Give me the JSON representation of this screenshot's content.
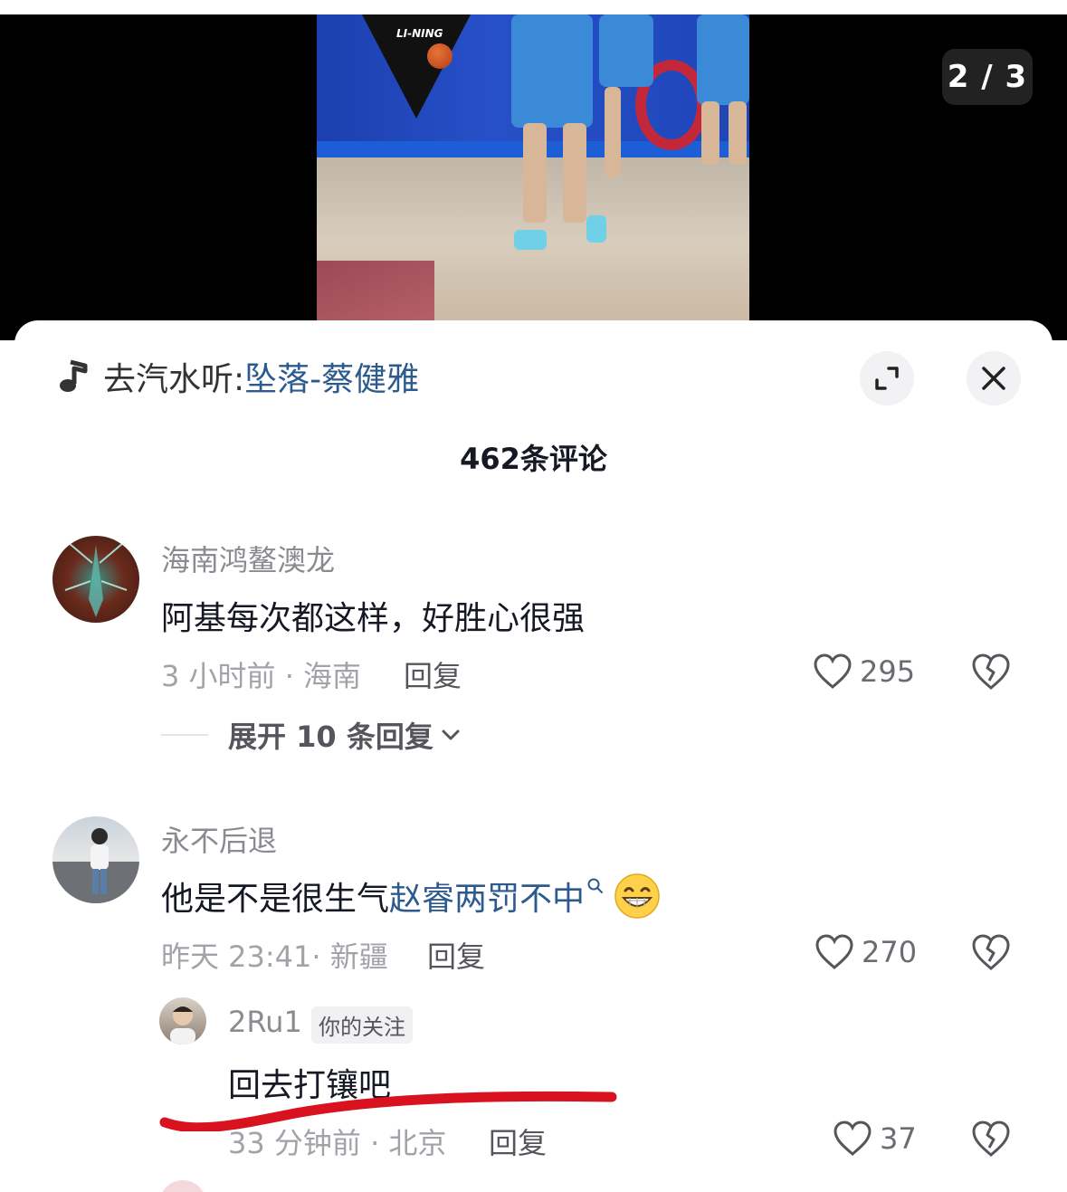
{
  "video": {
    "page_indicator": "2 / 3",
    "court_logo_text": "LI-NING"
  },
  "sheet": {
    "music_prefix": "去汽水听:",
    "music_song": "坠落-蔡健雅",
    "comment_count_title": "462条评论"
  },
  "comments": [
    {
      "username": "海南鸿鳌澳龙",
      "text": "阿基每次都这样，好胜心很强",
      "meta": "3 小时前 · 海南",
      "reply_label": "回复",
      "likes": "295",
      "expand_replies": "展开 10 条回复"
    },
    {
      "username": "永不后退",
      "text_prefix": "他是不是很生气",
      "text_link": "赵睿两罚不中",
      "meta": "昨天 23:41· 新疆",
      "reply_label": "回复",
      "likes": "270",
      "emoji": "grinning-face-emoji"
    }
  ],
  "reply": {
    "username": "2Ru1",
    "tag": "你的关注",
    "text": "回去打镶吧",
    "meta": "33 分钟前 · 北京",
    "reply_label": "回复",
    "likes": "37"
  },
  "icons": {
    "music": "music-note-icon",
    "expand": "expand-icon",
    "close": "close-icon",
    "like": "heart-outline-icon",
    "dislike": "broken-heart-icon",
    "search_hint": "search-icon",
    "chevron": "chevron-down-icon"
  },
  "colors": {
    "link": "#2c5a8e",
    "highlight_mark": "#d8121f",
    "muted": "#a2a3a8"
  }
}
